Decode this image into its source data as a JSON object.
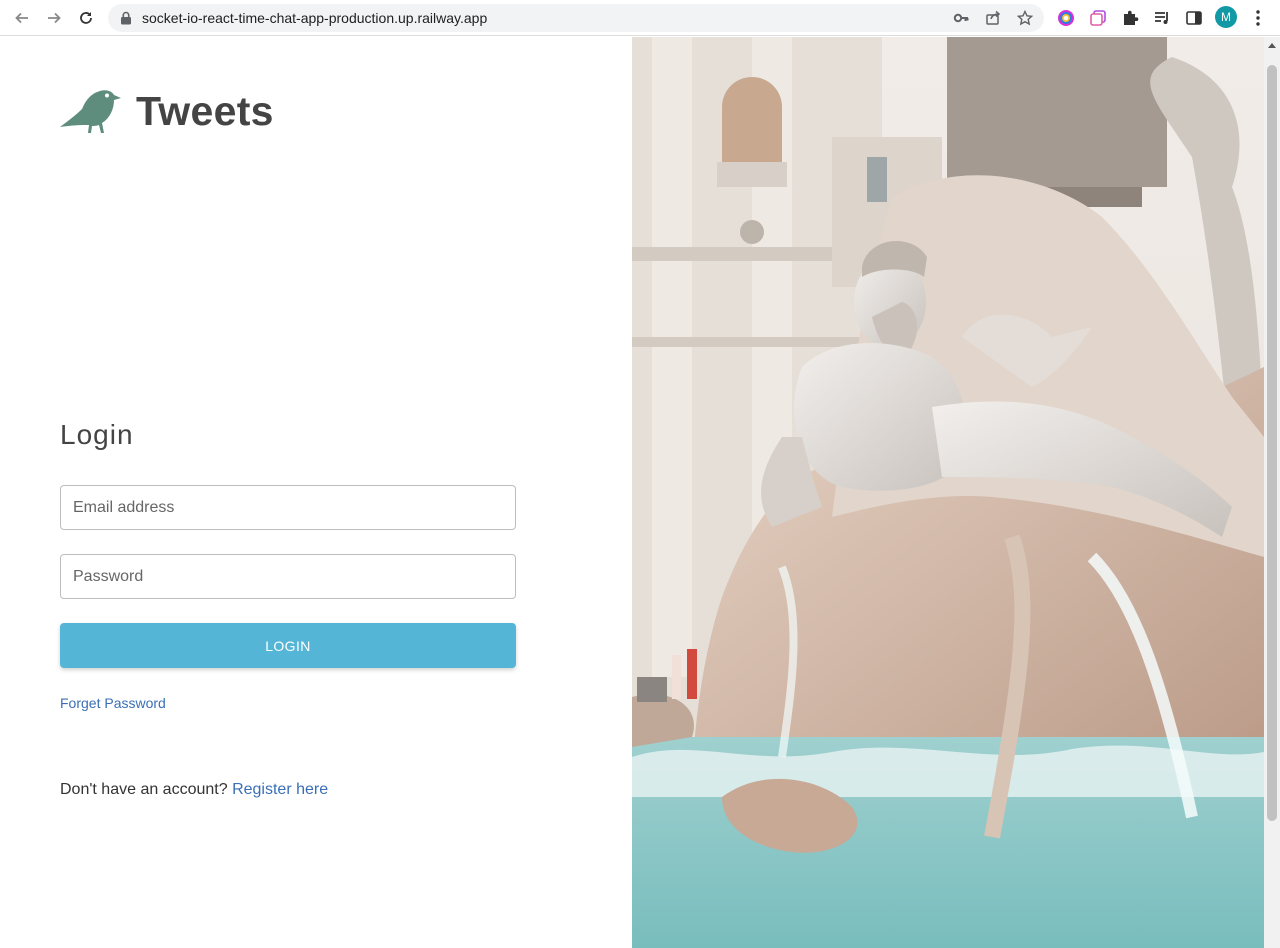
{
  "browser": {
    "url": "socket-io-react-time-chat-app-production.up.railway.app",
    "profile_initial": "M",
    "icons": [
      "back-icon",
      "forward-icon",
      "reload-icon",
      "lock-icon",
      "key-icon",
      "share-icon",
      "star-icon",
      "extension-color-icon",
      "extension-tabs-icon",
      "puzzle-icon",
      "media-icon",
      "sidebar-icon",
      "menu-icon"
    ]
  },
  "brand": {
    "name": "Tweets",
    "logo_icon": "bird-icon",
    "logo_color": "#5f8d7d"
  },
  "login": {
    "title": "Login",
    "email_placeholder": "Email address",
    "email_value": "",
    "password_placeholder": "Password",
    "password_value": "",
    "submit_label": "LOGIN",
    "forget_label": "Forget Password",
    "register_prompt": "Don't have an account? ",
    "register_link": "Register here"
  },
  "colors": {
    "button": "#54b5d7",
    "link": "#3a6fb6",
    "text": "#444444"
  }
}
